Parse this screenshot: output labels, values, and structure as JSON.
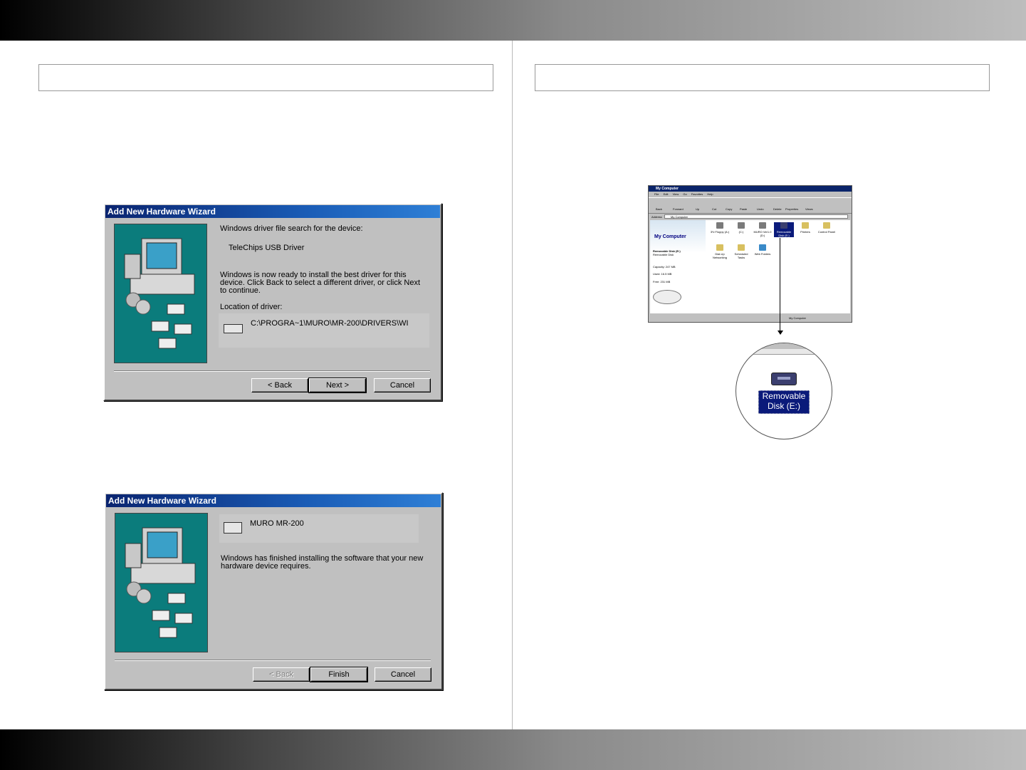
{
  "wizard1": {
    "title": "Add New Hardware Wizard",
    "heading": "Windows driver file search for the device:",
    "device": "TeleChips USB Driver",
    "message_line1": "Windows is now ready to install the best driver for this",
    "message_line2": "device. Click Back to select a different driver, or click Next",
    "message_line3": "to continue.",
    "location_label": "Location of driver:",
    "path": "C:\\PROGRA~1\\MURO\\MR-200\\DRIVERS\\WI",
    "back": "< Back",
    "next": "Next >",
    "cancel": "Cancel"
  },
  "wizard2": {
    "title": "Add New Hardware Wizard",
    "device": "MURO MR-200",
    "message_line1": "Windows has finished installing the software that your new",
    "message_line2": "hardware device requires.",
    "back": "< Back",
    "finish": "Finish",
    "cancel": "Cancel"
  },
  "explorer": {
    "title": "My Computer",
    "menu": [
      "File",
      "Edit",
      "View",
      "Go",
      "Favorites",
      "Help"
    ],
    "toolbar": [
      "Back",
      "Forward",
      "Up",
      "Cut",
      "Copy",
      "Paste",
      "Undo",
      "Delete",
      "Properties",
      "Views"
    ],
    "address_label": "Address",
    "address_value": "My Computer",
    "panel_title": "My Computer",
    "selected_name": "Removable Disk (E:)",
    "selected_type": "Removable Disk",
    "capacity": "Capacity: 247 MB",
    "used": "Used: 16.5 MB",
    "free": "Free: 231 MB",
    "icons": [
      "3½ Floppy (A:)",
      "(C:)",
      "MURO Ver1.0 (D:)",
      "Removable Disk (E:)",
      "Printers",
      "Control Panel",
      "Dial-Up Networking",
      "Scheduled Tasks",
      "Web Folders"
    ],
    "status": "My Computer"
  },
  "zoom": {
    "label_line1": "Removable",
    "label_line2": "Disk (E:)"
  },
  "colors": {
    "titlebar": "#0a246a",
    "dialog_face": "#c0c0c0",
    "wizard_art": "#0b7c7c"
  }
}
